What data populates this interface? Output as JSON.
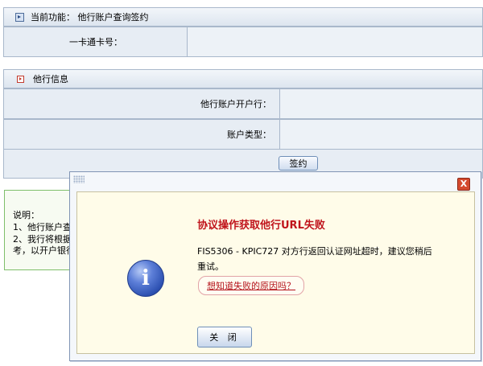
{
  "header": {
    "title": "当前功能： 他行账户查询签约"
  },
  "form": {
    "card_label": "一卡通卡号：",
    "section_title": "他行信息",
    "bank_label": "他行账户开户行：",
    "type_label": "账户类型：",
    "sign_button": "签约"
  },
  "explain": {
    "line1": "说明：",
    "line2": "1、他行账户查",
    "line3": "2、我行将根据",
    "line4": "考，以开户银行"
  },
  "dialog": {
    "title": "协议操作获取他行URL失败",
    "message_line1": "FIS5306 - KPIC727 对方行返回认证网址超时，建议您稍后",
    "message_line2": "重试。",
    "why_link": "想知道失败的原因吗？",
    "close_button": "关 闭",
    "close_x": "X"
  },
  "colors": {
    "accent_red": "#c0131b",
    "border_blue": "#a9b8cb",
    "dialog_bg": "#fffce9"
  },
  "icons": [
    "header-arrow-icon",
    "section-arrow-icon",
    "close-x-icon",
    "info-icon"
  ]
}
